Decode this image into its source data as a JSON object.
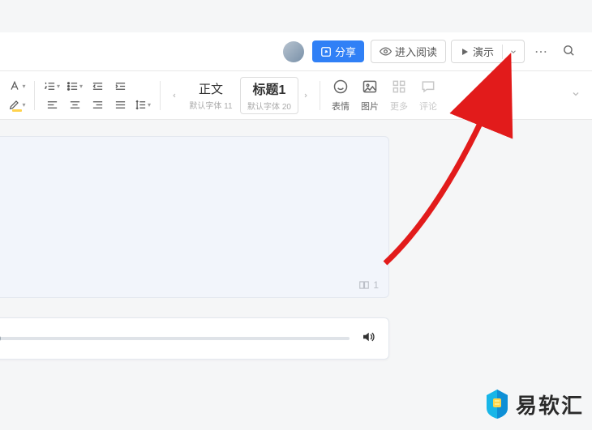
{
  "header": {
    "share_label": "分享",
    "read_label": "进入阅读",
    "present_label": "演示"
  },
  "toolbar": {
    "styles": {
      "body": {
        "label": "正文",
        "font": "默认字体 11"
      },
      "h1": {
        "label": "标题1",
        "font": "默认字体 20"
      }
    },
    "insert": {
      "emoji": "表情",
      "image": "图片",
      "more": "更多",
      "comment": "评论"
    }
  },
  "document": {
    "page_indicator": "1"
  },
  "watermark": {
    "text": "易软汇"
  },
  "annotation": {
    "arrow_color": "#e21b1b"
  }
}
